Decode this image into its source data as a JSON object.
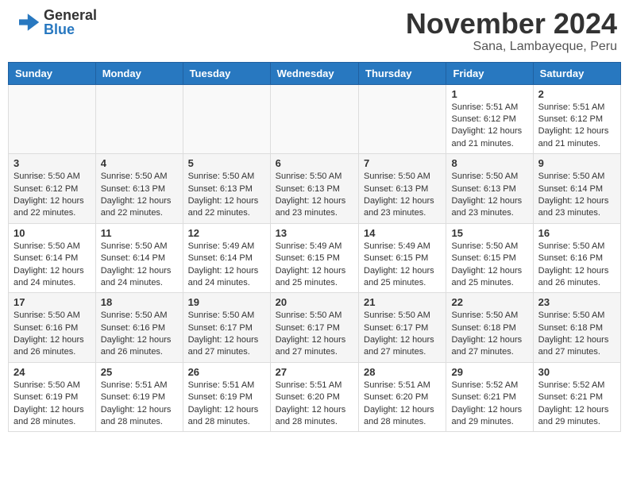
{
  "header": {
    "logo_general": "General",
    "logo_blue": "Blue",
    "month_title": "November 2024",
    "location": "Sana, Lambayeque, Peru"
  },
  "weekdays": [
    "Sunday",
    "Monday",
    "Tuesday",
    "Wednesday",
    "Thursday",
    "Friday",
    "Saturday"
  ],
  "weeks": [
    [
      {
        "day": "",
        "info": ""
      },
      {
        "day": "",
        "info": ""
      },
      {
        "day": "",
        "info": ""
      },
      {
        "day": "",
        "info": ""
      },
      {
        "day": "",
        "info": ""
      },
      {
        "day": "1",
        "info": "Sunrise: 5:51 AM\nSunset: 6:12 PM\nDaylight: 12 hours and 21 minutes."
      },
      {
        "day": "2",
        "info": "Sunrise: 5:51 AM\nSunset: 6:12 PM\nDaylight: 12 hours and 21 minutes."
      }
    ],
    [
      {
        "day": "3",
        "info": "Sunrise: 5:50 AM\nSunset: 6:12 PM\nDaylight: 12 hours and 22 minutes."
      },
      {
        "day": "4",
        "info": "Sunrise: 5:50 AM\nSunset: 6:13 PM\nDaylight: 12 hours and 22 minutes."
      },
      {
        "day": "5",
        "info": "Sunrise: 5:50 AM\nSunset: 6:13 PM\nDaylight: 12 hours and 22 minutes."
      },
      {
        "day": "6",
        "info": "Sunrise: 5:50 AM\nSunset: 6:13 PM\nDaylight: 12 hours and 23 minutes."
      },
      {
        "day": "7",
        "info": "Sunrise: 5:50 AM\nSunset: 6:13 PM\nDaylight: 12 hours and 23 minutes."
      },
      {
        "day": "8",
        "info": "Sunrise: 5:50 AM\nSunset: 6:13 PM\nDaylight: 12 hours and 23 minutes."
      },
      {
        "day": "9",
        "info": "Sunrise: 5:50 AM\nSunset: 6:14 PM\nDaylight: 12 hours and 23 minutes."
      }
    ],
    [
      {
        "day": "10",
        "info": "Sunrise: 5:50 AM\nSunset: 6:14 PM\nDaylight: 12 hours and 24 minutes."
      },
      {
        "day": "11",
        "info": "Sunrise: 5:50 AM\nSunset: 6:14 PM\nDaylight: 12 hours and 24 minutes."
      },
      {
        "day": "12",
        "info": "Sunrise: 5:49 AM\nSunset: 6:14 PM\nDaylight: 12 hours and 24 minutes."
      },
      {
        "day": "13",
        "info": "Sunrise: 5:49 AM\nSunset: 6:15 PM\nDaylight: 12 hours and 25 minutes."
      },
      {
        "day": "14",
        "info": "Sunrise: 5:49 AM\nSunset: 6:15 PM\nDaylight: 12 hours and 25 minutes."
      },
      {
        "day": "15",
        "info": "Sunrise: 5:50 AM\nSunset: 6:15 PM\nDaylight: 12 hours and 25 minutes."
      },
      {
        "day": "16",
        "info": "Sunrise: 5:50 AM\nSunset: 6:16 PM\nDaylight: 12 hours and 26 minutes."
      }
    ],
    [
      {
        "day": "17",
        "info": "Sunrise: 5:50 AM\nSunset: 6:16 PM\nDaylight: 12 hours and 26 minutes."
      },
      {
        "day": "18",
        "info": "Sunrise: 5:50 AM\nSunset: 6:16 PM\nDaylight: 12 hours and 26 minutes."
      },
      {
        "day": "19",
        "info": "Sunrise: 5:50 AM\nSunset: 6:17 PM\nDaylight: 12 hours and 27 minutes."
      },
      {
        "day": "20",
        "info": "Sunrise: 5:50 AM\nSunset: 6:17 PM\nDaylight: 12 hours and 27 minutes."
      },
      {
        "day": "21",
        "info": "Sunrise: 5:50 AM\nSunset: 6:17 PM\nDaylight: 12 hours and 27 minutes."
      },
      {
        "day": "22",
        "info": "Sunrise: 5:50 AM\nSunset: 6:18 PM\nDaylight: 12 hours and 27 minutes."
      },
      {
        "day": "23",
        "info": "Sunrise: 5:50 AM\nSunset: 6:18 PM\nDaylight: 12 hours and 27 minutes."
      }
    ],
    [
      {
        "day": "24",
        "info": "Sunrise: 5:50 AM\nSunset: 6:19 PM\nDaylight: 12 hours and 28 minutes."
      },
      {
        "day": "25",
        "info": "Sunrise: 5:51 AM\nSunset: 6:19 PM\nDaylight: 12 hours and 28 minutes."
      },
      {
        "day": "26",
        "info": "Sunrise: 5:51 AM\nSunset: 6:19 PM\nDaylight: 12 hours and 28 minutes."
      },
      {
        "day": "27",
        "info": "Sunrise: 5:51 AM\nSunset: 6:20 PM\nDaylight: 12 hours and 28 minutes."
      },
      {
        "day": "28",
        "info": "Sunrise: 5:51 AM\nSunset: 6:20 PM\nDaylight: 12 hours and 28 minutes."
      },
      {
        "day": "29",
        "info": "Sunrise: 5:52 AM\nSunset: 6:21 PM\nDaylight: 12 hours and 29 minutes."
      },
      {
        "day": "30",
        "info": "Sunrise: 5:52 AM\nSunset: 6:21 PM\nDaylight: 12 hours and 29 minutes."
      }
    ]
  ]
}
